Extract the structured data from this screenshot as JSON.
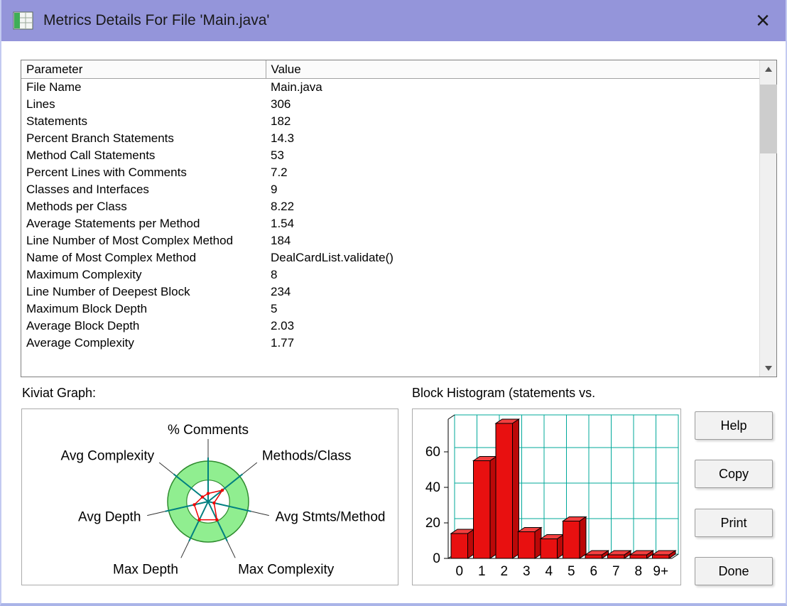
{
  "window": {
    "title": "Metrics Details For File 'Main.java'",
    "close_glyph": "×"
  },
  "sections": {
    "kiviat_label": "Kiviat Graph:",
    "histogram_label": "Block Histogram (statements vs."
  },
  "table": {
    "columns": [
      "Parameter",
      "Value"
    ],
    "rows": [
      [
        "File Name",
        "Main.java"
      ],
      [
        "Lines",
        "306"
      ],
      [
        "Statements",
        "182"
      ],
      [
        "Percent Branch Statements",
        "14.3"
      ],
      [
        "Method Call Statements",
        "53"
      ],
      [
        "Percent Lines with Comments",
        "7.2"
      ],
      [
        "Classes and Interfaces",
        "9"
      ],
      [
        "Methods per Class",
        "8.22"
      ],
      [
        "Average Statements per Method",
        "1.54"
      ],
      [
        "Line Number of Most Complex Method",
        "184"
      ],
      [
        "Name of Most Complex Method",
        "DealCardList.validate()"
      ],
      [
        "Maximum Complexity",
        "8"
      ],
      [
        "Line Number of Deepest Block",
        "234"
      ],
      [
        "Maximum Block Depth",
        "5"
      ],
      [
        "Average Block Depth",
        "2.03"
      ],
      [
        "Average Complexity",
        "1.77"
      ]
    ]
  },
  "buttons": [
    {
      "label": "Help"
    },
    {
      "label": "Copy"
    },
    {
      "label": "Print"
    },
    {
      "label": "Done"
    }
  ],
  "colors": {
    "titlebar": "#9495da",
    "kiviat_ring_fill": "#90ee90",
    "kiviat_ring_edge": "#2e8b2e",
    "spoke_teal": "#008080",
    "series_red": "#ee0000",
    "bar_red": "#e81010",
    "grid_teal": "#00a89a"
  },
  "chart_data": [
    {
      "type": "radar",
      "title": "Kiviat Graph",
      "axes": [
        "% Comments",
        "Methods/Class",
        "Avg Stmts/Method",
        "Max Complexity",
        "Max Depth",
        "Avg Depth",
        "Avg Complexity"
      ],
      "metric_values": [
        7.2,
        8.22,
        1.54,
        8,
        5,
        2.03,
        1.77
      ],
      "values_normalized": [
        0.2,
        0.45,
        0.15,
        0.5,
        0.5,
        0.35,
        0.18
      ],
      "ring": {
        "inner_fraction": 0.53,
        "fill": "#90ee90",
        "edge": "#2e8b2e"
      },
      "spoke_color": "#008080",
      "series_color": "#ee0000",
      "legend_position": "none"
    },
    {
      "type": "bar",
      "title": "Block Histogram (statements vs.",
      "categories": [
        "0",
        "1",
        "2",
        "3",
        "4",
        "5",
        "6",
        "7",
        "8",
        "9+"
      ],
      "values": [
        14,
        55,
        76,
        15,
        11,
        21,
        2,
        2,
        2,
        2
      ],
      "xlabel": "",
      "ylabel": "",
      "yticks": [
        0,
        20,
        40,
        60
      ],
      "ylim": [
        0,
        78
      ],
      "style": "3d-bars",
      "grid": true,
      "bar_color": "#e81010",
      "grid_color": "#00a89a",
      "legend_position": "none"
    }
  ]
}
